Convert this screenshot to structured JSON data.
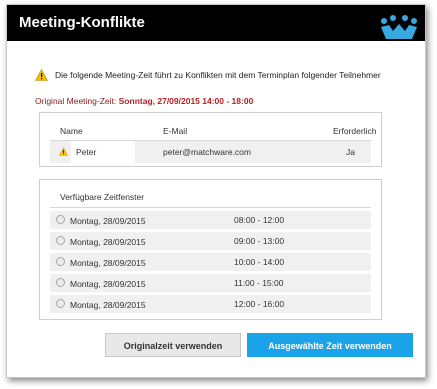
{
  "dialog": {
    "title": "Meeting-Konflikte",
    "warning_text": "Die folgende Meeting-Zeit führt zu Konflikten mit dem Terminplan folgender Teilnehmer",
    "original_label": "Original Meeting-Zeit:",
    "original_value": "Sonntag, 27/09/2015 14:00 - 18:00"
  },
  "participants": {
    "headers": {
      "name": "Name",
      "email": "E-Mail",
      "required": "Erforderlich"
    },
    "rows": [
      {
        "name": "Peter",
        "email": "peter@matchware.com",
        "required": "Ja"
      }
    ]
  },
  "slots": {
    "header": "Verfügbare Zeitfenster",
    "rows": [
      {
        "date": "Montag, 28/09/2015",
        "time": "08:00 - 12:00"
      },
      {
        "date": "Montag, 28/09/2015",
        "time": "09:00 - 13:00"
      },
      {
        "date": "Montag, 28/09/2015",
        "time": "10:00 - 14:00"
      },
      {
        "date": "Montag, 28/09/2015",
        "time": "11:00 - 15:00"
      },
      {
        "date": "Montag, 28/09/2015",
        "time": "12:00 - 16:00"
      }
    ]
  },
  "buttons": {
    "use_original": "Originalzeit verwenden",
    "use_selected": "Ausgewählte Zeit verwenden"
  },
  "colors": {
    "accent": "#1aa3e8",
    "titlebar": "#000000",
    "warning": "#f2c200",
    "original_time": "#b22222"
  },
  "icons": {
    "logo": "matchware-people-logo",
    "warning": "warning-triangle-icon",
    "slot_select": "radio-button"
  }
}
